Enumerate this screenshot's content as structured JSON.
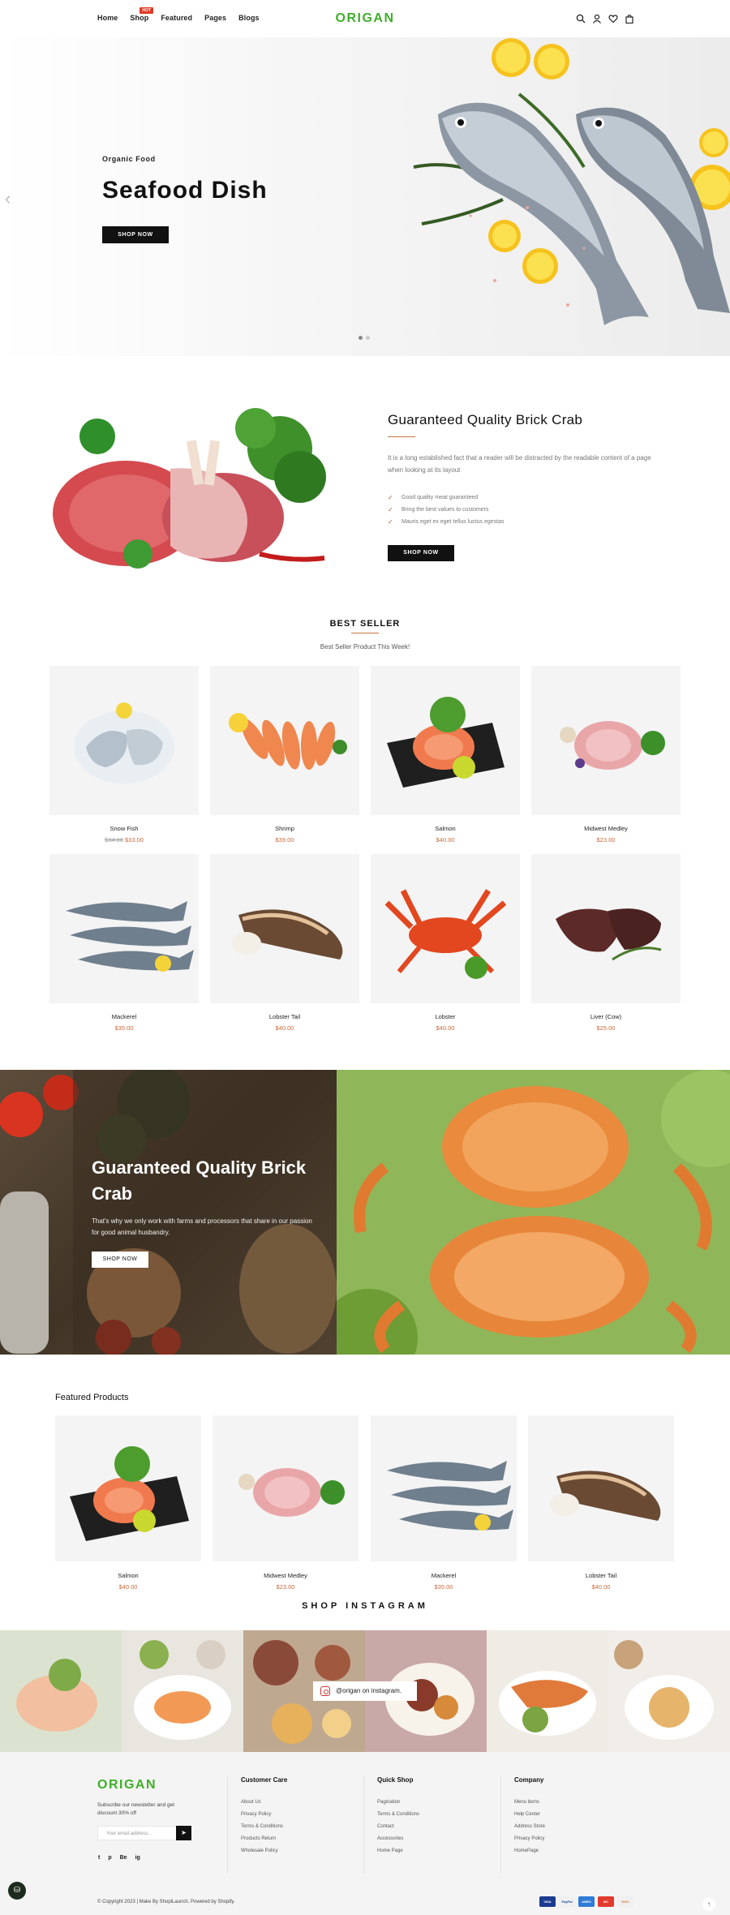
{
  "header": {
    "nav": [
      {
        "label": "Home"
      },
      {
        "label": "Shop",
        "badge": "HOT"
      },
      {
        "label": "Featured"
      },
      {
        "label": "Pages"
      },
      {
        "label": "Blogs"
      }
    ],
    "logo": "ORIGAN",
    "icons": [
      "search-icon",
      "user-icon",
      "heart-icon",
      "bag-icon"
    ]
  },
  "hero": {
    "subtitle": "Organic Food",
    "title": "Seafood Dish",
    "button": "SHOP NOW"
  },
  "about": {
    "title": "Guaranteed Quality Brick Crab",
    "text": "It is a long established fact that a reader will be distracted by the readable content of a page when looking at its layout",
    "list": [
      "Good quality meat guaranteed",
      "Bring the best values to customers",
      "Mauris eget ex eget tellus luctus egestas"
    ],
    "button": "SHOP NOW"
  },
  "best_seller": {
    "title": "BEST SELLER",
    "subtitle": "Best Seller Product This Week!",
    "products": [
      {
        "name": "Snow Fish",
        "old_price": "$34.00",
        "price": "$33.00"
      },
      {
        "name": "Shrimp",
        "old_price": "",
        "price": "$39.00"
      },
      {
        "name": "Salmon",
        "old_price": "",
        "price": "$40.00"
      },
      {
        "name": "Midwest Medley",
        "old_price": "",
        "price": "$23.00"
      },
      {
        "name": "Mackerel",
        "old_price": "",
        "price": "$35.00"
      },
      {
        "name": "Lobster Tail",
        "old_price": "",
        "price": "$40.00"
      },
      {
        "name": "Lobster",
        "old_price": "",
        "price": "$40.00"
      },
      {
        "name": "Liver (Cow)",
        "old_price": "",
        "price": "$25.00"
      }
    ]
  },
  "banner": {
    "title": "Guaranteed Quality Brick Crab",
    "text": "That's why we only work with farms and processors that share in our passion for good animal husbandry.",
    "button": "SHOP NOW"
  },
  "featured": {
    "title": "Featured Products",
    "products": [
      {
        "name": "Salmon",
        "price": "$40.00"
      },
      {
        "name": "Midwest Medley",
        "price": "$23.00"
      },
      {
        "name": "Mackerel",
        "price": "$35.00"
      },
      {
        "name": "Lobster Tail",
        "price": "$40.00"
      }
    ]
  },
  "instagram": {
    "title": "SHOP INSTAGRAM",
    "handle": "@origan on instagram."
  },
  "footer": {
    "logo": "ORIGAN",
    "newsletter_text": "Subscribe our newsletter and get discount 30% off",
    "email_placeholder": "Your email address...",
    "social": [
      "t",
      "p",
      "Be",
      "ig"
    ],
    "columns": [
      {
        "title": "Customer Care",
        "links": [
          "About Us",
          "Privacy Policy",
          "Terms & Conditions",
          "Products Return",
          "Wholesale Policy"
        ]
      },
      {
        "title": "Quick Shop",
        "links": [
          "Pagination",
          "Terms & Conditions",
          "Contact",
          "Accessories",
          "Home Page"
        ]
      },
      {
        "title": "Company",
        "links": [
          "Menu items",
          "Help Center",
          "Address Store",
          "Privacy Policy",
          "HomePage"
        ]
      }
    ],
    "copyright": "© Copyright 2023 | Make By ShopiLaunch. Powered by Shopify.",
    "payments": [
      "VISA",
      "PayPal",
      "AMEX",
      "MC",
      "DISC"
    ]
  }
}
